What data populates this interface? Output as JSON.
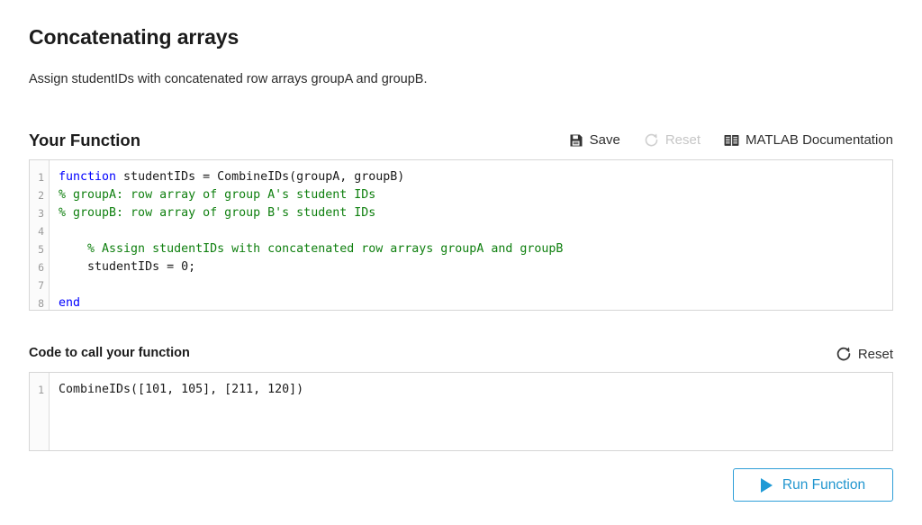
{
  "header": {
    "title": "Concatenating arrays",
    "description": "Assign studentIDs with concatenated row arrays groupA and groupB."
  },
  "function_section": {
    "title": "Your Function",
    "toolbar": {
      "save_label": "Save",
      "save_icon": "save-floppy-icon",
      "reset_label": "Reset",
      "reset_icon": "refresh-circular-arrow-icon",
      "reset_disabled": true,
      "docs_label": "MATLAB Documentation",
      "docs_icon": "book-icon"
    },
    "editor": {
      "line_numbers": [
        "1",
        "2",
        "3",
        "4",
        "5",
        "6",
        "7",
        "8"
      ],
      "lines": [
        [
          {
            "t": "function",
            "c": "keyword"
          },
          {
            "t": " studentIDs = CombineIDs(groupA, groupB)",
            "c": "plain"
          }
        ],
        [
          {
            "t": "% groupA: row array of group A's student IDs",
            "c": "comment"
          }
        ],
        [
          {
            "t": "% groupB: row array of group B's student IDs",
            "c": "comment"
          }
        ],
        [
          {
            "t": "",
            "c": "plain"
          }
        ],
        [
          {
            "t": "    % Assign studentIDs with concatenated row arrays groupA and groupB",
            "c": "comment"
          }
        ],
        [
          {
            "t": "    studentIDs = 0;",
            "c": "plain"
          }
        ],
        [
          {
            "t": "",
            "c": "plain"
          }
        ],
        [
          {
            "t": "end",
            "c": "keyword"
          }
        ]
      ]
    }
  },
  "call_section": {
    "title": "Code to call your function",
    "reset_label": "Reset",
    "reset_icon": "refresh-circular-arrow-icon",
    "editor": {
      "line_numbers": [
        "1"
      ],
      "lines": [
        [
          {
            "t": "CombineIDs([101, 105], [211, 120])",
            "c": "plain"
          }
        ]
      ]
    }
  },
  "run": {
    "label": "Run Function",
    "icon": "play-triangle-icon"
  },
  "colors": {
    "accent_blue": "#1e9ad6",
    "keyword_blue": "#0000ff",
    "comment_green": "#108010",
    "disabled_grey": "#c6c6c6",
    "border_grey": "#d6d6d6"
  }
}
